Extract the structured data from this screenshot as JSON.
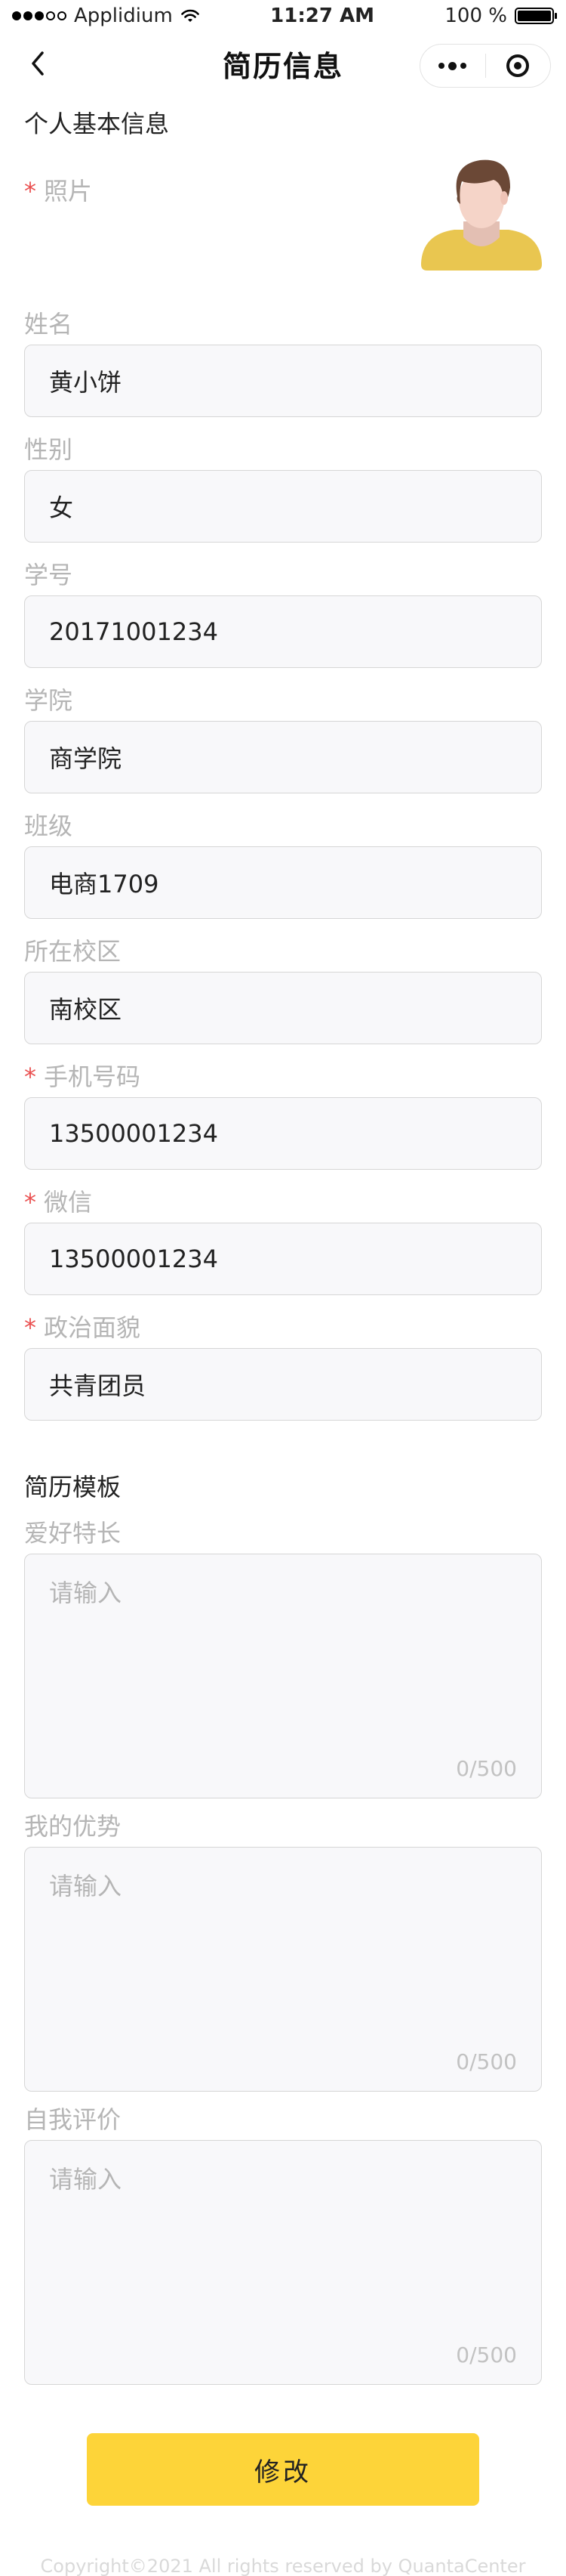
{
  "status_bar": {
    "carrier": "Applidium",
    "time": "11:27 AM",
    "battery": "100 %"
  },
  "nav": {
    "title": "简历信息"
  },
  "basic_info": {
    "title": "个人基本信息",
    "photo_label": "照片",
    "required_mark": "*",
    "fields": [
      {
        "label": "姓名",
        "value": "黄小饼",
        "required": false
      },
      {
        "label": "性别",
        "value": "女",
        "required": false
      },
      {
        "label": "学号",
        "value": "20171001234",
        "required": false
      },
      {
        "label": "学院",
        "value": "商学院",
        "required": false
      },
      {
        "label": "班级",
        "value": "电商1709",
        "required": false
      },
      {
        "label": "所在校区",
        "value": "南校区",
        "required": false
      },
      {
        "label": "手机号码",
        "value": "13500001234",
        "required": true
      },
      {
        "label": "微信",
        "value": "13500001234",
        "required": true
      },
      {
        "label": "政治面貌",
        "value": "共青团员",
        "required": true
      }
    ]
  },
  "resume_template": {
    "title": "简历模板",
    "textareas": [
      {
        "label": "爱好特长",
        "placeholder": "请输入",
        "counter": "0/500"
      },
      {
        "label": "我的优势",
        "placeholder": "请输入",
        "counter": "0/500"
      },
      {
        "label": "自我评价",
        "placeholder": "请输入",
        "counter": "0/500"
      }
    ]
  },
  "submit_label": "修改",
  "footer": "Copyright©2021 All rights reserved by QuantaCenter",
  "colors": {
    "accent": "#fdd439",
    "required": "#ea5050",
    "field_bg": "#f8f8fa"
  },
  "icons": {
    "back": "chevron-left-icon",
    "more": "more-dots-icon",
    "close": "target-circle-icon",
    "wifi": "wifi-icon",
    "battery": "battery-icon"
  }
}
